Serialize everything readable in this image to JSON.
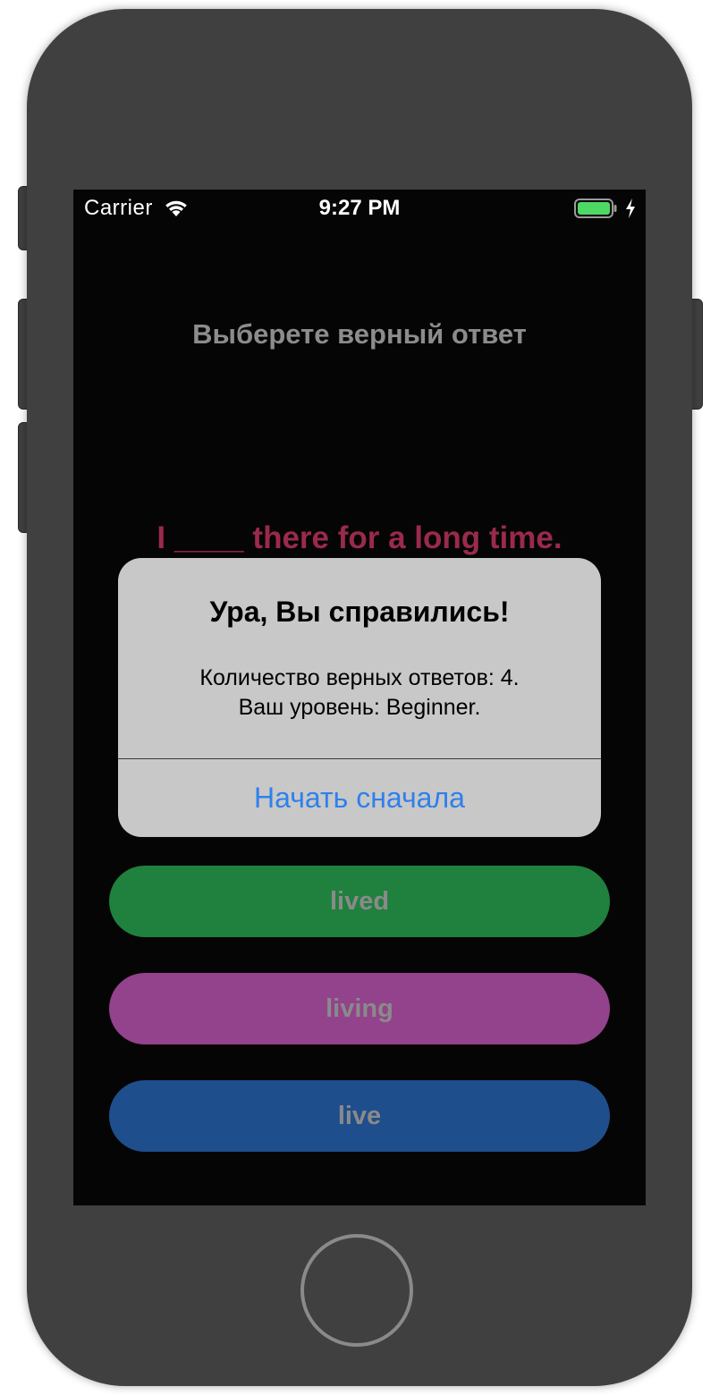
{
  "status_bar": {
    "carrier": "Carrier",
    "time": "9:27 PM",
    "wifi_icon": "wifi-icon",
    "battery_icon": "battery-icon",
    "battery_level": 1.0,
    "charging_icon": "charging-bolt-icon"
  },
  "quiz": {
    "prompt": "Выберете верный ответ",
    "question": "I ____ there for a long time.",
    "answers": [
      {
        "label": "",
        "color": "#050505"
      },
      {
        "label": "lived",
        "color": "#20803e"
      },
      {
        "label": "living",
        "color": "#93428c"
      },
      {
        "label": "live",
        "color": "#1f4e8c"
      }
    ]
  },
  "alert": {
    "title": "Ура, Вы справились!",
    "message_line1": "Количество верных ответов: 4.",
    "message_line2": "Ваш уровень: Beginner.",
    "action_label": "Начать сначала",
    "action_color": "#2f80ec"
  },
  "colors": {
    "screen_background": "#050505",
    "question_text": "#9a2a4c",
    "prompt_text": "#8c8c8c",
    "device_body": "#404040"
  }
}
